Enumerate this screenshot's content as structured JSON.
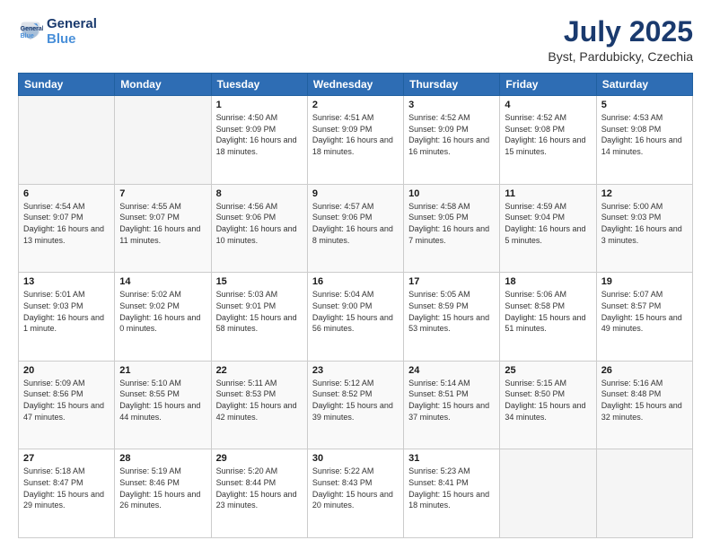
{
  "header": {
    "logo_line1": "General",
    "logo_line2": "Blue",
    "title": "July 2025",
    "subtitle": "Byst, Pardubicky, Czechia"
  },
  "weekdays": [
    "Sunday",
    "Monday",
    "Tuesday",
    "Wednesday",
    "Thursday",
    "Friday",
    "Saturday"
  ],
  "weeks": [
    [
      {
        "day": "",
        "sunrise": "",
        "sunset": "",
        "daylight": "",
        "empty": true
      },
      {
        "day": "",
        "sunrise": "",
        "sunset": "",
        "daylight": "",
        "empty": true
      },
      {
        "day": "1",
        "sunrise": "Sunrise: 4:50 AM",
        "sunset": "Sunset: 9:09 PM",
        "daylight": "Daylight: 16 hours and 18 minutes.",
        "empty": false
      },
      {
        "day": "2",
        "sunrise": "Sunrise: 4:51 AM",
        "sunset": "Sunset: 9:09 PM",
        "daylight": "Daylight: 16 hours and 18 minutes.",
        "empty": false
      },
      {
        "day": "3",
        "sunrise": "Sunrise: 4:52 AM",
        "sunset": "Sunset: 9:09 PM",
        "daylight": "Daylight: 16 hours and 16 minutes.",
        "empty": false
      },
      {
        "day": "4",
        "sunrise": "Sunrise: 4:52 AM",
        "sunset": "Sunset: 9:08 PM",
        "daylight": "Daylight: 16 hours and 15 minutes.",
        "empty": false
      },
      {
        "day": "5",
        "sunrise": "Sunrise: 4:53 AM",
        "sunset": "Sunset: 9:08 PM",
        "daylight": "Daylight: 16 hours and 14 minutes.",
        "empty": false
      }
    ],
    [
      {
        "day": "6",
        "sunrise": "Sunrise: 4:54 AM",
        "sunset": "Sunset: 9:07 PM",
        "daylight": "Daylight: 16 hours and 13 minutes.",
        "empty": false
      },
      {
        "day": "7",
        "sunrise": "Sunrise: 4:55 AM",
        "sunset": "Sunset: 9:07 PM",
        "daylight": "Daylight: 16 hours and 11 minutes.",
        "empty": false
      },
      {
        "day": "8",
        "sunrise": "Sunrise: 4:56 AM",
        "sunset": "Sunset: 9:06 PM",
        "daylight": "Daylight: 16 hours and 10 minutes.",
        "empty": false
      },
      {
        "day": "9",
        "sunrise": "Sunrise: 4:57 AM",
        "sunset": "Sunset: 9:06 PM",
        "daylight": "Daylight: 16 hours and 8 minutes.",
        "empty": false
      },
      {
        "day": "10",
        "sunrise": "Sunrise: 4:58 AM",
        "sunset": "Sunset: 9:05 PM",
        "daylight": "Daylight: 16 hours and 7 minutes.",
        "empty": false
      },
      {
        "day": "11",
        "sunrise": "Sunrise: 4:59 AM",
        "sunset": "Sunset: 9:04 PM",
        "daylight": "Daylight: 16 hours and 5 minutes.",
        "empty": false
      },
      {
        "day": "12",
        "sunrise": "Sunrise: 5:00 AM",
        "sunset": "Sunset: 9:03 PM",
        "daylight": "Daylight: 16 hours and 3 minutes.",
        "empty": false
      }
    ],
    [
      {
        "day": "13",
        "sunrise": "Sunrise: 5:01 AM",
        "sunset": "Sunset: 9:03 PM",
        "daylight": "Daylight: 16 hours and 1 minute.",
        "empty": false
      },
      {
        "day": "14",
        "sunrise": "Sunrise: 5:02 AM",
        "sunset": "Sunset: 9:02 PM",
        "daylight": "Daylight: 16 hours and 0 minutes.",
        "empty": false
      },
      {
        "day": "15",
        "sunrise": "Sunrise: 5:03 AM",
        "sunset": "Sunset: 9:01 PM",
        "daylight": "Daylight: 15 hours and 58 minutes.",
        "empty": false
      },
      {
        "day": "16",
        "sunrise": "Sunrise: 5:04 AM",
        "sunset": "Sunset: 9:00 PM",
        "daylight": "Daylight: 15 hours and 56 minutes.",
        "empty": false
      },
      {
        "day": "17",
        "sunrise": "Sunrise: 5:05 AM",
        "sunset": "Sunset: 8:59 PM",
        "daylight": "Daylight: 15 hours and 53 minutes.",
        "empty": false
      },
      {
        "day": "18",
        "sunrise": "Sunrise: 5:06 AM",
        "sunset": "Sunset: 8:58 PM",
        "daylight": "Daylight: 15 hours and 51 minutes.",
        "empty": false
      },
      {
        "day": "19",
        "sunrise": "Sunrise: 5:07 AM",
        "sunset": "Sunset: 8:57 PM",
        "daylight": "Daylight: 15 hours and 49 minutes.",
        "empty": false
      }
    ],
    [
      {
        "day": "20",
        "sunrise": "Sunrise: 5:09 AM",
        "sunset": "Sunset: 8:56 PM",
        "daylight": "Daylight: 15 hours and 47 minutes.",
        "empty": false
      },
      {
        "day": "21",
        "sunrise": "Sunrise: 5:10 AM",
        "sunset": "Sunset: 8:55 PM",
        "daylight": "Daylight: 15 hours and 44 minutes.",
        "empty": false
      },
      {
        "day": "22",
        "sunrise": "Sunrise: 5:11 AM",
        "sunset": "Sunset: 8:53 PM",
        "daylight": "Daylight: 15 hours and 42 minutes.",
        "empty": false
      },
      {
        "day": "23",
        "sunrise": "Sunrise: 5:12 AM",
        "sunset": "Sunset: 8:52 PM",
        "daylight": "Daylight: 15 hours and 39 minutes.",
        "empty": false
      },
      {
        "day": "24",
        "sunrise": "Sunrise: 5:14 AM",
        "sunset": "Sunset: 8:51 PM",
        "daylight": "Daylight: 15 hours and 37 minutes.",
        "empty": false
      },
      {
        "day": "25",
        "sunrise": "Sunrise: 5:15 AM",
        "sunset": "Sunset: 8:50 PM",
        "daylight": "Daylight: 15 hours and 34 minutes.",
        "empty": false
      },
      {
        "day": "26",
        "sunrise": "Sunrise: 5:16 AM",
        "sunset": "Sunset: 8:48 PM",
        "daylight": "Daylight: 15 hours and 32 minutes.",
        "empty": false
      }
    ],
    [
      {
        "day": "27",
        "sunrise": "Sunrise: 5:18 AM",
        "sunset": "Sunset: 8:47 PM",
        "daylight": "Daylight: 15 hours and 29 minutes.",
        "empty": false
      },
      {
        "day": "28",
        "sunrise": "Sunrise: 5:19 AM",
        "sunset": "Sunset: 8:46 PM",
        "daylight": "Daylight: 15 hours and 26 minutes.",
        "empty": false
      },
      {
        "day": "29",
        "sunrise": "Sunrise: 5:20 AM",
        "sunset": "Sunset: 8:44 PM",
        "daylight": "Daylight: 15 hours and 23 minutes.",
        "empty": false
      },
      {
        "day": "30",
        "sunrise": "Sunrise: 5:22 AM",
        "sunset": "Sunset: 8:43 PM",
        "daylight": "Daylight: 15 hours and 20 minutes.",
        "empty": false
      },
      {
        "day": "31",
        "sunrise": "Sunrise: 5:23 AM",
        "sunset": "Sunset: 8:41 PM",
        "daylight": "Daylight: 15 hours and 18 minutes.",
        "empty": false
      },
      {
        "day": "",
        "sunrise": "",
        "sunset": "",
        "daylight": "",
        "empty": true
      },
      {
        "day": "",
        "sunrise": "",
        "sunset": "",
        "daylight": "",
        "empty": true
      }
    ]
  ]
}
